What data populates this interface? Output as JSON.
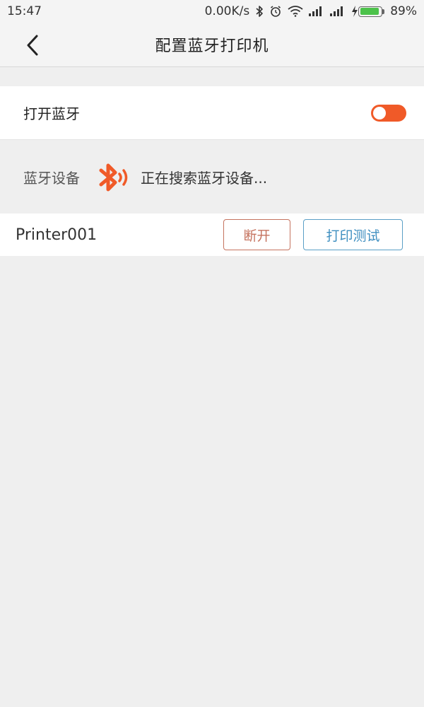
{
  "status_bar": {
    "time": "15:47",
    "net_speed": "0.00K/s",
    "battery_percent": "89%",
    "battery_level": 0.89,
    "icons": [
      "bluetooth-icon",
      "alarm-icon",
      "wifi-icon",
      "signal-icon",
      "signal-icon",
      "charging-icon",
      "battery-icon"
    ],
    "battery_color": "#4cc24a"
  },
  "header": {
    "title": "配置蓝牙打印机",
    "back_icon": "chevron-left-icon"
  },
  "bluetooth_toggle": {
    "label": "打开蓝牙",
    "state": "on",
    "color": "#f05a28"
  },
  "devices": {
    "label": "蓝牙设备",
    "searching_text": "正在搜索蓝牙设备...",
    "icon": "bluetooth-searching-icon",
    "icon_color": "#f05a28"
  },
  "printer": {
    "name": "Printer001",
    "disconnect_label": "断开",
    "test_label": "打印测试",
    "disconnect_color": "#c5735f",
    "test_color": "#3f8fc0"
  }
}
